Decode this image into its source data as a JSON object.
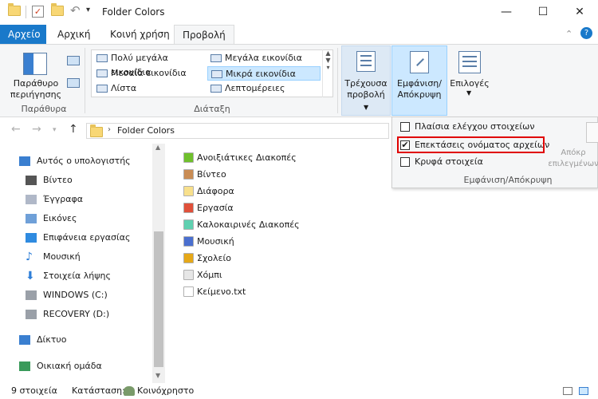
{
  "window": {
    "title": "Folder Colors",
    "minimize": "—",
    "maximize": "☐",
    "close": "✕"
  },
  "tabs": [
    {
      "label": "Αρχείο"
    },
    {
      "label": "Αρχική"
    },
    {
      "label": "Κοινή χρήση"
    },
    {
      "label": "Προβολή"
    }
  ],
  "ribbon": {
    "panes": {
      "label": "Παράθυρο περιήγησης",
      "group": "Παράθυρα"
    },
    "layout": {
      "group": "Διάταξη",
      "items": [
        {
          "label": "Πολύ μεγάλα εικονίδια"
        },
        {
          "label": "Μεγάλα εικονίδια"
        },
        {
          "label": "Μεσαία εικονίδια"
        },
        {
          "label": "Μικρά εικονίδια"
        },
        {
          "label": "Λίστα"
        },
        {
          "label": "Λεπτομέρειες"
        }
      ]
    },
    "current_view": {
      "label": "Τρέχουσα προβολή"
    },
    "show_hide": {
      "label": "Εμφάνιση/ Απόκρυψη"
    },
    "options": {
      "label": "Επιλογές"
    }
  },
  "dropdown": {
    "items": [
      {
        "label": "Πλαίσια ελέγχου στοιχείων",
        "checked": ""
      },
      {
        "label": "Επεκτάσεις ονόματος αρχείων",
        "checked": "✔"
      },
      {
        "label": "Κρυφά στοιχεία",
        "checked": ""
      }
    ],
    "side_label": "Απόκρ επιλεγμένων",
    "group": "Εμφάνιση/Απόκρυψη"
  },
  "address": {
    "path": "Folder Colors"
  },
  "nav": [
    {
      "label": "Αυτός ο υπολογιστής",
      "icon": "computer-icon"
    },
    {
      "label": "Βίντεο",
      "icon": "video-icon"
    },
    {
      "label": "Έγγραφα",
      "icon": "documents-icon"
    },
    {
      "label": "Εικόνες",
      "icon": "pictures-icon"
    },
    {
      "label": "Επιφάνεια εργασίας",
      "icon": "desktop-icon"
    },
    {
      "label": "Μουσική",
      "icon": "music-icon"
    },
    {
      "label": "Στοιχεία λήψης",
      "icon": "downloads-icon"
    },
    {
      "label": "WINDOWS (C:)",
      "icon": "drive-icon"
    },
    {
      "label": "RECOVERY (D:)",
      "icon": "drive-icon"
    },
    {
      "label": "Δίκτυο",
      "icon": "network-icon"
    },
    {
      "label": "Οικιακή ομάδα",
      "icon": "homegroup-icon"
    }
  ],
  "files": [
    {
      "name": "Ανοιξιάτικες Διακοπές",
      "color": "#6fc02c"
    },
    {
      "name": "Βίντεο",
      "color": "#c98c54"
    },
    {
      "name": "Διάφορα",
      "color": "#f8e08c"
    },
    {
      "name": "Εργασία",
      "color": "#e0503a"
    },
    {
      "name": "Καλοκαιρινές Διακοπές",
      "color": "#5fd0b0"
    },
    {
      "name": "Μουσική",
      "color": "#4a6fcf"
    },
    {
      "name": "Σχολείο",
      "color": "#e6a818"
    },
    {
      "name": "Χόμπι",
      "color": "#e6e6e6"
    },
    {
      "name": "Κείμενο.txt",
      "color": "#ffffff"
    }
  ],
  "status": {
    "count": "9 στοιχεία",
    "state_label": "Κατάσταση:",
    "state_value": "Κοινόχρηστο"
  }
}
